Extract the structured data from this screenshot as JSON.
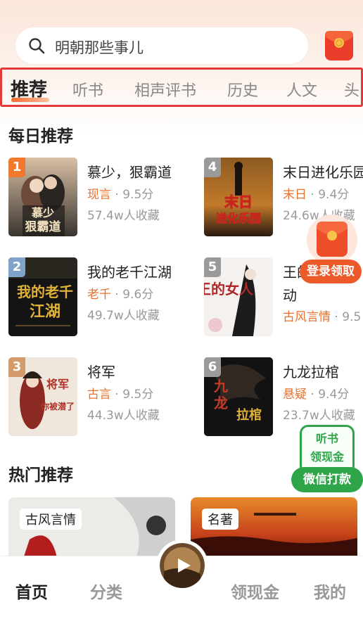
{
  "search": {
    "placeholder": "明朝那些事儿"
  },
  "tabs": [
    {
      "label": "推荐",
      "active": true
    },
    {
      "label": "听书"
    },
    {
      "label": "相声评书"
    },
    {
      "label": "历史"
    },
    {
      "label": "人文"
    },
    {
      "label": "头"
    }
  ],
  "daily": {
    "title": "每日推荐",
    "books": [
      {
        "rank": "1",
        "title": "慕少，狠霸道",
        "genre": "现言",
        "score": "9.5分",
        "count": "57.4w人收藏",
        "rank_color": "#f0792e"
      },
      {
        "rank": "2",
        "title": "我的老千江湖",
        "genre": "老千",
        "score": "9.6分",
        "count": "49.7w人收藏",
        "rank_color": "#7fa3c9"
      },
      {
        "rank": "3",
        "title": "将军",
        "genre": "古言",
        "score": "9.5分",
        "count": "44.3w人收藏",
        "rank_color": "#d39a6a"
      },
      {
        "rank": "4",
        "title": "末日进化乐园",
        "genre": "末日",
        "score": "9.4分",
        "count": "24.6w人收藏",
        "rank_color": "#9a9a9a"
      },
      {
        "rank": "5",
        "title": "王的",
        "title2": "动",
        "genre": "古风言情",
        "score": "9.5",
        "count": "",
        "rank_color": "#9a9a9a"
      },
      {
        "rank": "6",
        "title": "九龙拉棺",
        "genre": "悬疑",
        "score": "9.4分",
        "count": "23.7w人收藏",
        "rank_color": "#9a9a9a"
      }
    ],
    "separator": "·"
  },
  "cover_text": {
    "b1_a": "慕少",
    "b1_b": "狠霸道",
    "b2_a": "我的老千",
    "b2_b": "江湖",
    "b3_a": "将军",
    "b3_b": "你被潜了",
    "b4_a": "末日",
    "b4_b": "进化乐园",
    "b5_a": "王的女人",
    "b6_a": "九",
    "b6_b": "龙",
    "b6_c": "拉棺"
  },
  "hot": {
    "title": "热门推荐",
    "cards": [
      {
        "tag": "古风言情"
      },
      {
        "tag": "名著"
      }
    ]
  },
  "float_env": {
    "label": "登录领取"
  },
  "cashbox": {
    "line1": "听书",
    "line2": "领现金",
    "button": "微信打款"
  },
  "nav": {
    "items": [
      {
        "label": "首页",
        "active": true
      },
      {
        "label": "分类"
      },
      {
        "label": "领现金"
      },
      {
        "label": "我的"
      }
    ],
    "center_icon": "play-icon"
  },
  "colors": {
    "accent": "#ed5a2a",
    "genre": "#e8712f",
    "green": "#2ea548",
    "highlight_box": "#e33a3a"
  }
}
